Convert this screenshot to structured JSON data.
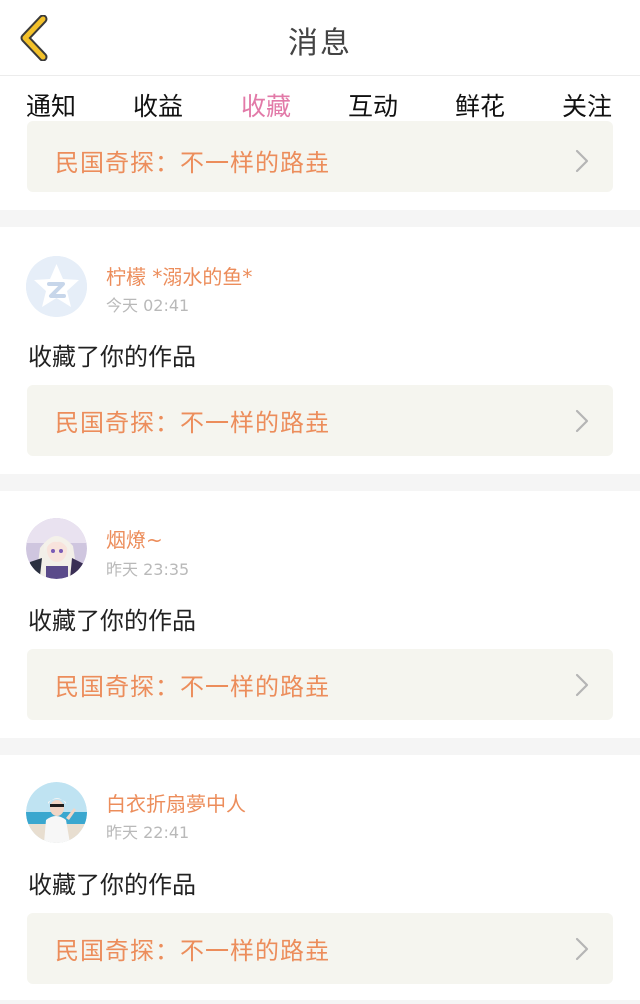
{
  "header": {
    "title": "消息",
    "back_icon": "chevron-left-icon"
  },
  "tabs": [
    {
      "label": "通知"
    },
    {
      "label": "收益"
    },
    {
      "label": "收藏",
      "active": true
    },
    {
      "label": "互动"
    },
    {
      "label": "鲜花"
    },
    {
      "label": "关注"
    }
  ],
  "partial_item": {
    "work_title": "民国奇探：不一样的路垚"
  },
  "items": [
    {
      "username": "柠檬 *溺水的鱼*",
      "time": "今天 02:41",
      "action": "收藏了你的作品",
      "work_title": "民国奇探：不一样的路垚",
      "avatar": "default-star-avatar"
    },
    {
      "username": "烟燎~",
      "time": "昨天 23:35",
      "action": "收藏了你的作品",
      "work_title": "民国奇探：不一样的路垚",
      "avatar": "anime-girl-avatar"
    },
    {
      "username": "白衣折扇夢中人",
      "time": "昨天 22:41",
      "action": "收藏了你的作品",
      "work_title": "民国奇探：不一样的路垚",
      "avatar": "beach-photo-avatar"
    }
  ],
  "colors": {
    "accent_pink": "#e27aa8",
    "accent_orange": "#ec8d5b",
    "back_yellow": "#f3c12a",
    "card_bg": "#f5f5ef"
  }
}
